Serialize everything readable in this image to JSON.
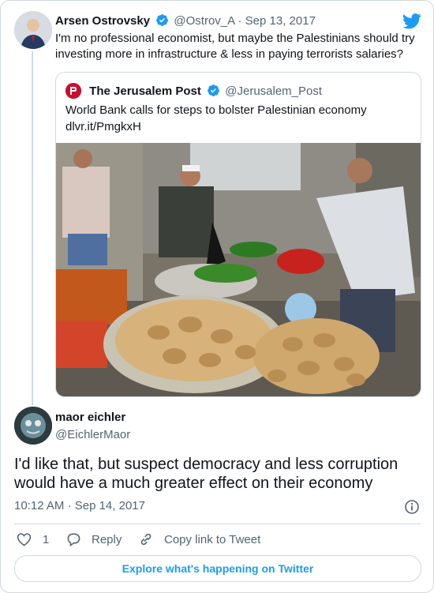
{
  "tweet": {
    "author_name": "Arsen Ostrovsky",
    "handle": "@Ostrov_A",
    "separator": "·",
    "date": "Sep 13, 2017",
    "text": "I'm no professional economist, but maybe the Palestinians should try investing more in infrastructure & less in paying terrorists salaries?"
  },
  "quoted": {
    "author_name": "The Jerusalem Post",
    "handle": "@Jerusalem_Post",
    "text_line1": "World Bank calls for steps to bolster Palestinian economy",
    "link": "dlvr.it/PmgkxH"
  },
  "reply": {
    "author_name": "maor eichler",
    "handle": "@EichlerMaor",
    "text": "I'd like that, but suspect democracy and less corruption would have a much greater effect on their economy",
    "time": "10:12 AM",
    "separator": "·",
    "date": "Sep 14, 2017"
  },
  "actions": {
    "like_count": "1",
    "reply_label": "Reply",
    "copy_label": "Copy link to Tweet"
  },
  "explore_label": "Explore what's happening on Twitter",
  "colors": {
    "accent": "#1d9bf0",
    "border": "#cfd9de",
    "muted": "#536471",
    "verified": "#1d9bf0"
  },
  "icons": [
    "twitter-bird-icon",
    "verified-badge-icon",
    "info-icon",
    "heart-icon",
    "reply-bubble-icon",
    "link-icon"
  ]
}
